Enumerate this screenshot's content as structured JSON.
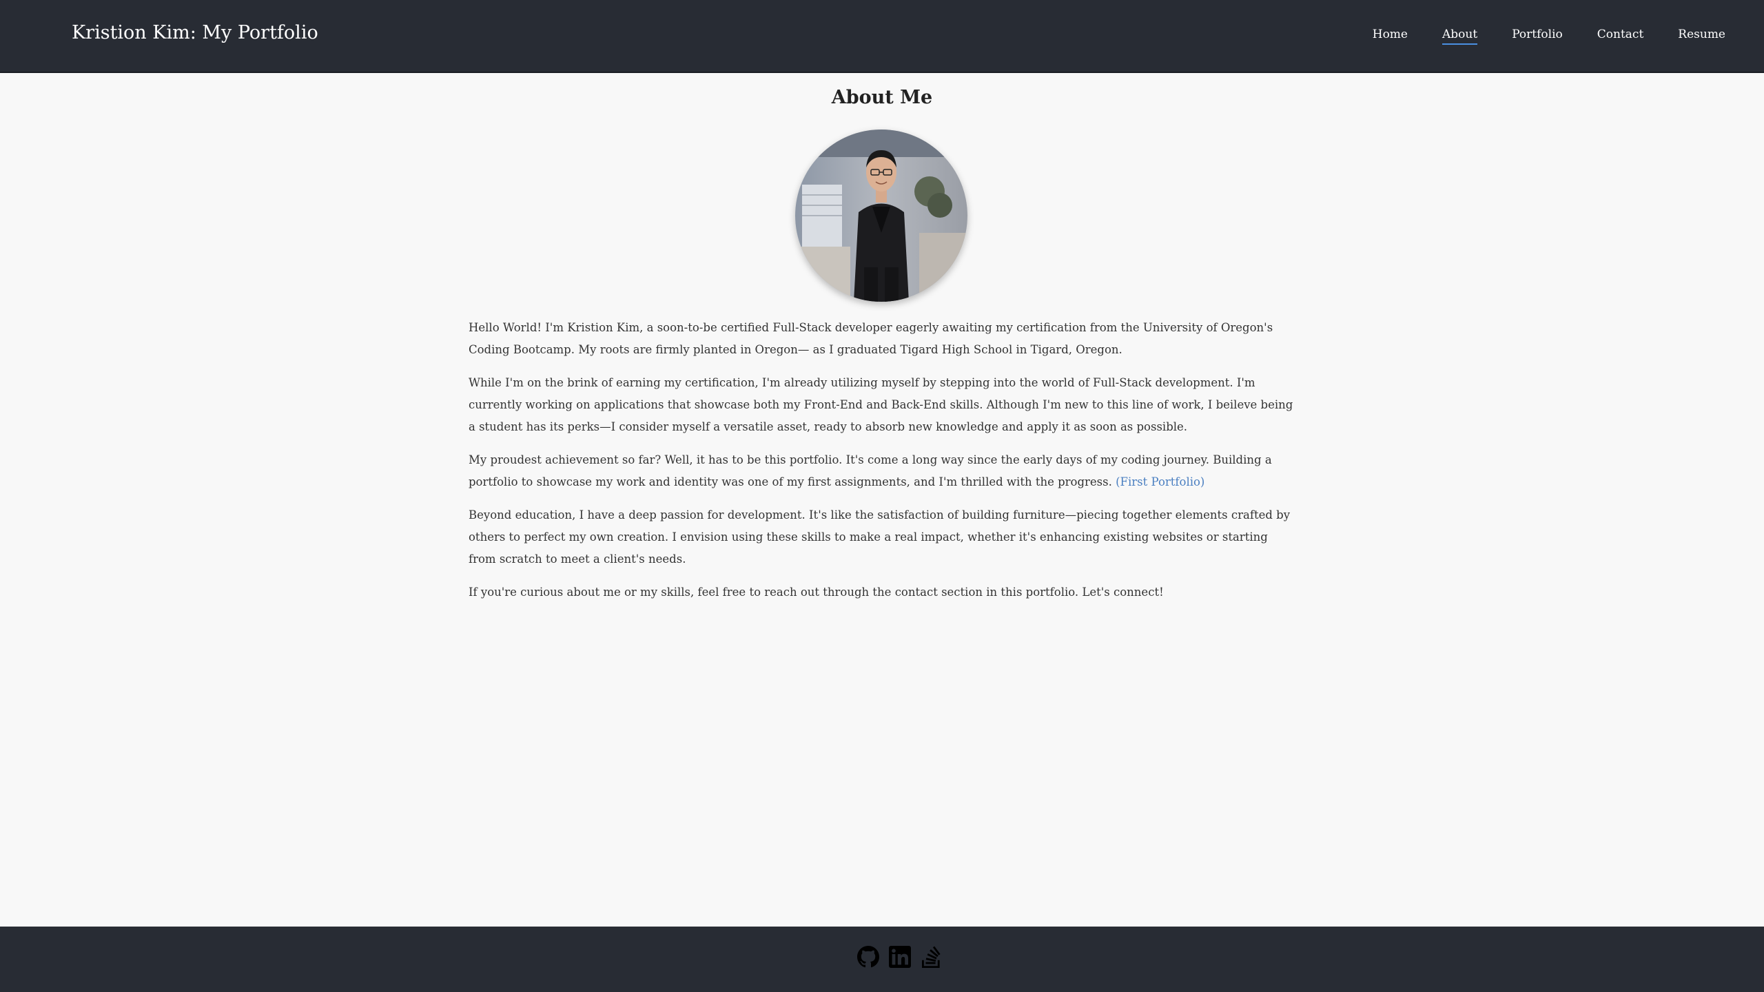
{
  "header": {
    "brand": "Kristion Kim: My Portfolio",
    "nav": [
      {
        "label": "Home"
      },
      {
        "label": "About",
        "active": true
      },
      {
        "label": "Portfolio"
      },
      {
        "label": "Contact"
      },
      {
        "label": "Resume"
      }
    ]
  },
  "main": {
    "title": "About Me",
    "paragraphs": [
      "Hello World! I'm Kristion Kim, a soon-to-be certified Full-Stack developer eagerly awaiting my certification from the University of Oregon's Coding Bootcamp. My roots are firmly planted in Oregon— as I graduated Tigard High School in Tigard, Oregon.",
      "While I'm on the brink of earning my certification, I'm already utilizing myself by stepping into the world of Full-Stack development. I'm currently working on applications that showcase both my Front-End and Back-End skills. Although I'm new to this line of work, I beileve being a student has its perks—I consider myself a versatile asset, ready to absorb new knowledge and apply it as soon as possible.",
      "My proudest achievement so far? Well, it has to be this portfolio. It's come a long way since the early days of my coding journey. Building a portfolio to showcase my work and identity was one of my first assignments, and I'm thrilled with the progress.",
      "Beyond education, I have a deep passion for development. It's like the satisfaction of building furniture—piecing together elements crafted by others to perfect my own creation. I envision using these skills to make a real impact, whether it's enhancing existing websites or starting from scratch to meet a client's needs.",
      "If you're curious about me or my skills, feel free to reach out through the contact section in this portfolio. Let's connect!"
    ],
    "first_portfolio_link": "(First Portfolio)"
  },
  "footer": {
    "icons": [
      "github-icon",
      "linkedin-icon",
      "stackoverflow-icon"
    ]
  },
  "colors": {
    "header_bg": "#282c34",
    "page_bg": "#f8f8f8",
    "link": "#4a7fc1",
    "active_underline": "#4a90e2"
  }
}
